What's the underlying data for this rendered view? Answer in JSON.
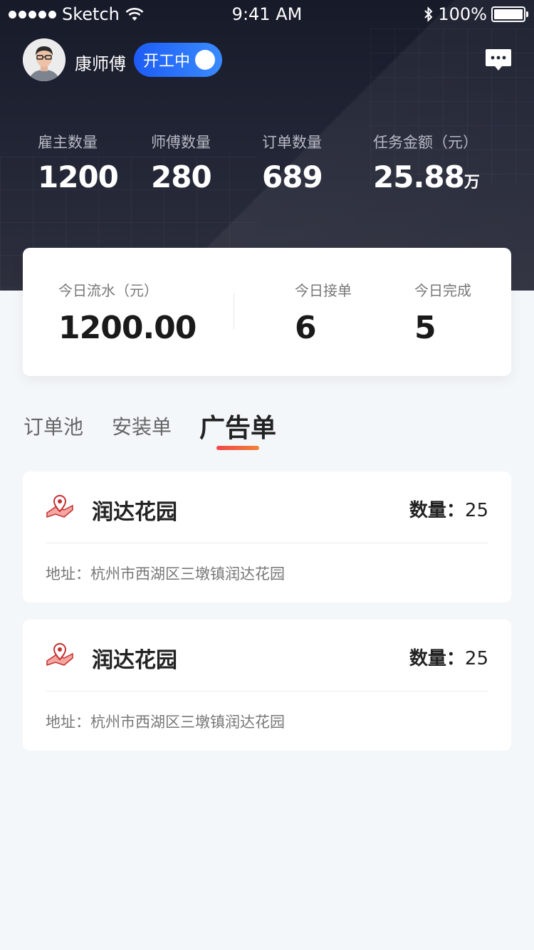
{
  "status_bar": {
    "carrier": "Sketch",
    "time": "9:41 AM",
    "battery": "100%"
  },
  "profile": {
    "name": "康师傅",
    "work_status": "开工中"
  },
  "stats": [
    {
      "label": "雇主数量",
      "value": "1200"
    },
    {
      "label": "师傅数量",
      "value": "280"
    },
    {
      "label": "订单数量",
      "value": "689"
    },
    {
      "label": "任务金额（元）",
      "value": "25.88",
      "unit": "万"
    }
  ],
  "today": {
    "flow_label": "今日流水（元）",
    "flow_value": "1200.00",
    "accepted_label": "今日接单",
    "accepted_value": "6",
    "completed_label": "今日完成",
    "completed_value": "5"
  },
  "tabs": [
    {
      "label": "订单池",
      "active": false
    },
    {
      "label": "安装单",
      "active": false
    },
    {
      "label": "广告单",
      "active": true
    }
  ],
  "orders": [
    {
      "name": "润达花园",
      "qty_label": "数量：",
      "qty": "25",
      "address": "地址：杭州市西湖区三墩镇润达花园"
    },
    {
      "name": "润达花园",
      "qty_label": "数量：",
      "qty": "25",
      "address": "地址：杭州市西湖区三墩镇润达花园"
    }
  ],
  "icons": {
    "wifi": "wifi-icon",
    "bluetooth": "bluetooth-icon",
    "message": "message-icon",
    "location": "location-pin-icon"
  },
  "colors": {
    "header_bg": "#1c1f2e",
    "toggle_blue": "#2f6bff",
    "tab_accent": "#f0493f",
    "page_bg": "#f4f7fa"
  }
}
